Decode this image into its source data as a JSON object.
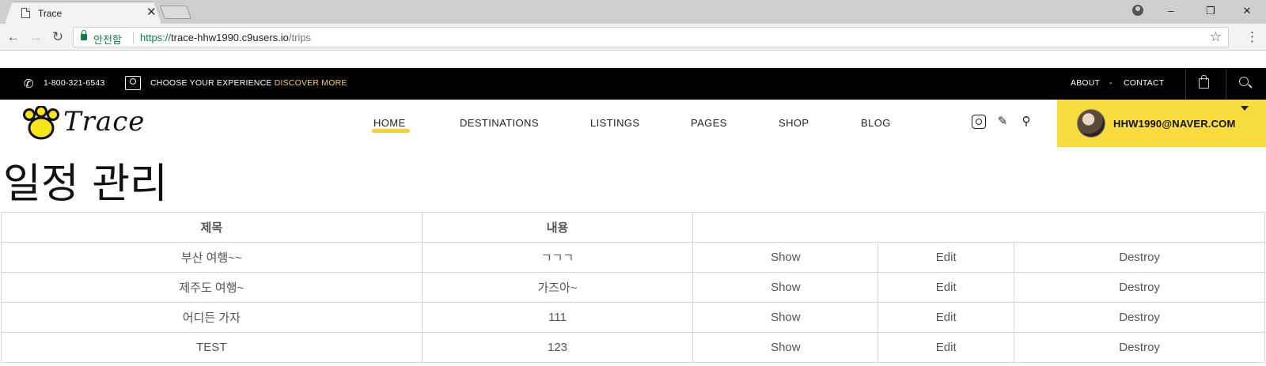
{
  "browser": {
    "tab_title": "Trace",
    "secure_label": "안전함",
    "url_scheme": "https://",
    "url_host": "trace-hhw1990.c9users.io",
    "url_path": "/trips"
  },
  "topbar": {
    "phone": "1-800-321-6543",
    "choose_text": "CHOOSE YOUR EXPERIENCE",
    "discover_text": "DISCOVER MORE",
    "about": "ABOUT",
    "dash": "-",
    "contact": "CONTACT"
  },
  "nav": {
    "logo": "Trace",
    "items": [
      "HOME",
      "DESTINATIONS",
      "LISTINGS",
      "PAGES",
      "SHOP",
      "BLOG"
    ],
    "user_email": "HHW1990@NAVER.COM",
    "accent_color": "#f8dc3e"
  },
  "page": {
    "title": "일정 관리"
  },
  "table": {
    "headers": [
      "제목",
      "내용",
      ""
    ],
    "rows": [
      {
        "title": "부산 여행~~",
        "content": "ㄱㄱㄱ",
        "show": "Show",
        "edit": "Edit",
        "destroy": "Destroy"
      },
      {
        "title": "제주도 여행~",
        "content": "가즈아~",
        "show": "Show",
        "edit": "Edit",
        "destroy": "Destroy"
      },
      {
        "title": "어디든 가자",
        "content": "111",
        "show": "Show",
        "edit": "Edit",
        "destroy": "Destroy"
      },
      {
        "title": "TEST",
        "content": "123",
        "show": "Show",
        "edit": "Edit",
        "destroy": "Destroy"
      }
    ],
    "link_color": "#e07a5f"
  }
}
